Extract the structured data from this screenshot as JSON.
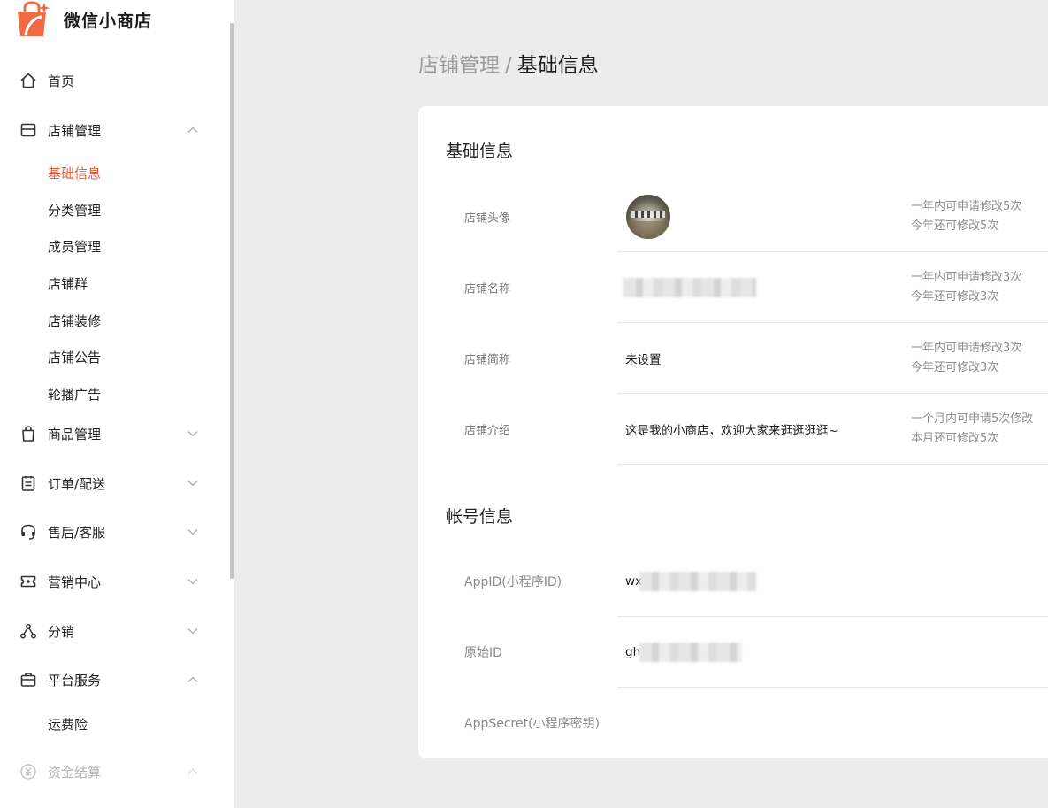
{
  "app": {
    "brand": "微信小商店",
    "accent": "#e8593a",
    "logo_icon": "shopping-bag-sparkle-icon"
  },
  "sidebar": {
    "items": [
      {
        "label": "首页",
        "icon": "home-icon"
      },
      {
        "label": "店铺管理",
        "icon": "store-icon",
        "expanded": true
      },
      {
        "label": "商品管理",
        "icon": "shopping-bag-icon",
        "expanded": false
      },
      {
        "label": "订单/配送",
        "icon": "clipboard-icon",
        "expanded": false
      },
      {
        "label": "售后/客服",
        "icon": "headset-icon",
        "expanded": false
      },
      {
        "label": "营销中心",
        "icon": "ticket-icon",
        "expanded": false
      },
      {
        "label": "分销",
        "icon": "share-network-icon",
        "expanded": false
      },
      {
        "label": "平台服务",
        "icon": "briefcase-icon",
        "expanded": true
      },
      {
        "label": "资金结算",
        "icon": "yen-icon",
        "expanded": true,
        "disabled": true
      }
    ],
    "store_sub": [
      "基础信息",
      "分类管理",
      "成员管理",
      "店铺群",
      "店铺装修",
      "店铺公告",
      "轮播广告"
    ],
    "store_sub_active": "基础信息",
    "platform_sub": [
      "运费险"
    ]
  },
  "breadcrumb": {
    "parent": "店铺管理",
    "separator": "/",
    "current": "基础信息"
  },
  "basic_info": {
    "title": "基础信息",
    "rows": [
      {
        "label": "店铺头像",
        "note1": "一年内可申请修改5次",
        "note2": "今年还可修改5次"
      },
      {
        "label": "店铺名称",
        "note1": "一年内可申请修改3次",
        "note2": "今年还可修改3次"
      },
      {
        "label": "店铺简称",
        "value": "未设置",
        "note1": "一年内可申请修改3次",
        "note2": "今年还可修改3次"
      },
      {
        "label": "店铺介绍",
        "value": "这是我的小商店，欢迎大家来逛逛逛逛~",
        "note1": "一个月内可申请5次修改",
        "note2": "本月还可修改5次"
      }
    ]
  },
  "account_info": {
    "title": "帐号信息",
    "rows": [
      {
        "label": "AppID(小程序ID)",
        "value_prefix": "wx"
      },
      {
        "label": "原始ID",
        "value_prefix": "gh"
      },
      {
        "label": "AppSecret(小程序密钥)"
      }
    ]
  }
}
